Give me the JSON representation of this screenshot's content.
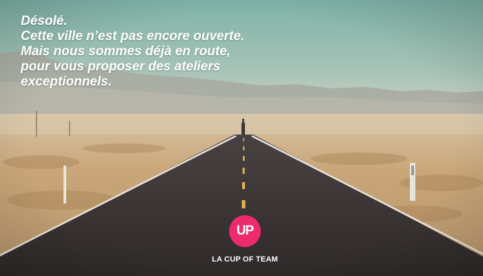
{
  "message": {
    "lines": [
      "Désolé.",
      "Cette ville n’est pas encore ouverte.",
      "Mais nous sommes déjà en route,",
      "pour vous proposer des ateliers",
      "exceptionnels."
    ]
  },
  "logo": {
    "text": "UP",
    "color": "#ee2a6f"
  },
  "brand": {
    "name": "LA CUP OF TEAM"
  },
  "colors": {
    "sky": "#93bdb4",
    "road": "#3a3333",
    "desert": "#c9a679",
    "text": "#ffffff"
  }
}
